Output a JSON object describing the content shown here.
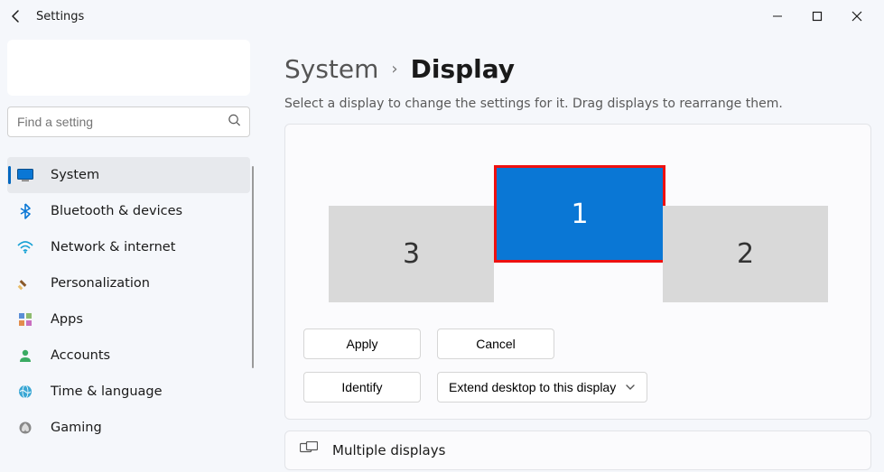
{
  "window": {
    "title": "Settings"
  },
  "search": {
    "placeholder": "Find a setting"
  },
  "nav": {
    "items": [
      {
        "label": "System",
        "icon": "system",
        "selected": true
      },
      {
        "label": "Bluetooth & devices",
        "icon": "bluetooth"
      },
      {
        "label": "Network & internet",
        "icon": "network"
      },
      {
        "label": "Personalization",
        "icon": "personalization"
      },
      {
        "label": "Apps",
        "icon": "apps"
      },
      {
        "label": "Accounts",
        "icon": "accounts"
      },
      {
        "label": "Time & language",
        "icon": "time"
      },
      {
        "label": "Gaming",
        "icon": "gaming"
      }
    ]
  },
  "breadcrumb": {
    "parent": "System",
    "current": "Display"
  },
  "subtitle": "Select a display to change the settings for it. Drag displays to rearrange them.",
  "displays": {
    "m1": "1",
    "m2": "2",
    "m3": "3"
  },
  "buttons": {
    "apply": "Apply",
    "cancel": "Cancel",
    "identify": "Identify"
  },
  "dropdown": {
    "label": "Extend desktop to this display"
  },
  "sections": {
    "multiple_displays": "Multiple displays"
  }
}
